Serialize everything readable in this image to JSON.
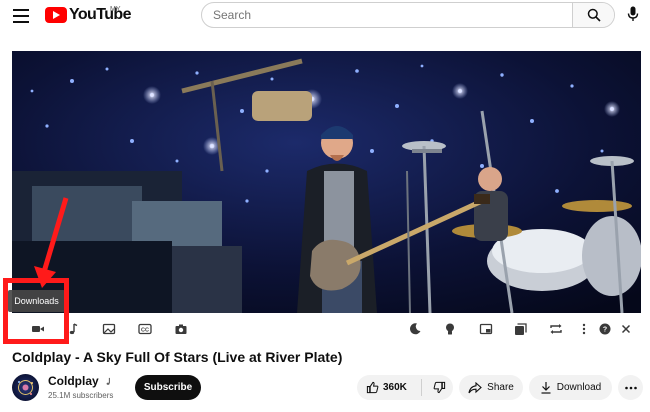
{
  "header": {
    "logo_text": "YouTube",
    "country_code": "MY",
    "search_placeholder": "Search",
    "icons": [
      "menu-icon",
      "search-icon",
      "microphone-icon"
    ]
  },
  "player": {
    "tooltip": "Downloads",
    "controls": [
      "video-camera-icon",
      "music-note-icon",
      "image-icon",
      "closed-captions-icon",
      "camera-icon",
      "moon-icon",
      "lightbulb-icon",
      "picture-in-picture-icon",
      "playlist-icon",
      "loop-icon",
      "more-vertical-icon",
      "help-icon",
      "close-icon"
    ],
    "closed_captions_label": "CC"
  },
  "video": {
    "title": "Coldplay - A Sky Full Of Stars (Live at River Plate)"
  },
  "channel": {
    "name": "Coldplay",
    "subscribers": "25.1M subscribers",
    "subscribe_label": "Subscribe"
  },
  "actions": {
    "likes": "360K",
    "share_label": "Share",
    "download_label": "Download"
  },
  "colors": {
    "brand_red": "#ff0000",
    "annotation_red": "#ff1a1a",
    "text": "#0f0f0f",
    "secondary_text": "#606060",
    "pill_bg": "#f2f2f2"
  }
}
